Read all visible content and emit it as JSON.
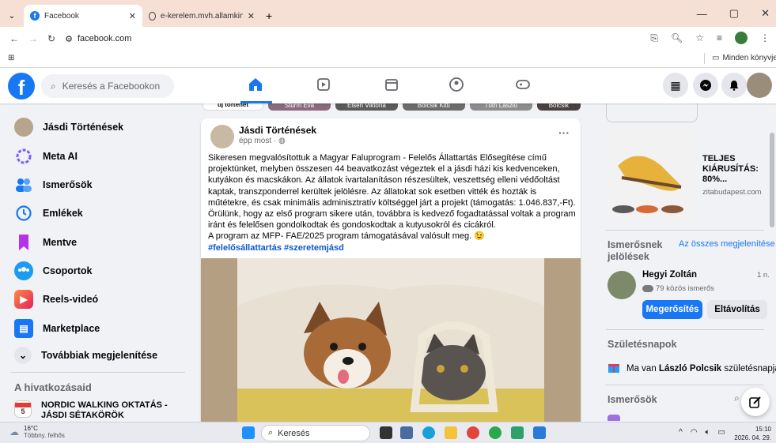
{
  "browser": {
    "tabs": [
      {
        "title": "Facebook",
        "active": true
      },
      {
        "title": "e-kerelem.mvh.allamkincstar.g",
        "active": false
      }
    ],
    "new_tab": "+",
    "url": "facebook.com",
    "bookmarks_label": "Minden könyvjelző"
  },
  "fb": {
    "search_placeholder": "Keresés a Facebookon",
    "logo": "f"
  },
  "leftnav": {
    "items": [
      {
        "label": "Jásdi Történések",
        "icon": "page-avatar"
      },
      {
        "label": "Meta AI",
        "icon": "meta-ai-icon"
      },
      {
        "label": "Ismerősök",
        "icon": "friends-icon"
      },
      {
        "label": "Emlékek",
        "icon": "memories-icon"
      },
      {
        "label": "Mentve",
        "icon": "saved-icon"
      },
      {
        "label": "Csoportok",
        "icon": "groups-icon"
      },
      {
        "label": "Reels-videó",
        "icon": "reels-icon"
      },
      {
        "label": "Marketplace",
        "icon": "marketplace-icon"
      },
      {
        "label": "Továbbiak megjelenítése",
        "icon": "chevron-down-icon"
      }
    ],
    "shortcuts_title": "A hivatkozásaid",
    "shortcut": {
      "line1": "NORDIC WALKING OKTATÁS -",
      "line2": "JÁSDI SÉTAKÖRÖK",
      "day": "5"
    }
  },
  "stories": [
    "új történet",
    "Sturm Éva",
    "Elsen Viktória",
    "Bolcsik Kitti",
    "Tóth László",
    "Bolcsik"
  ],
  "post": {
    "author": "Jásdi Történések",
    "time": "épp most ·",
    "more": "···",
    "paragraphs": [
      "Sikeresen megvalósítottuk a Magyar Faluprogram - Felelős Állattartás Elősegítése című projektünket, melyben összesen 44 beavatkozást végeztek el a jásdi házi kis kedvenceken, kutyákon és macskákon. Az állatok ivartalanításon részesültek, veszettség elleni védőoltást kaptak, transzponderrel kerültek jelölésre. Az állatokat sok esetben vitték és hozták is műtétekre, és csak minimális adminisztratív költséggel járt a projekt (támogatás: 1.046.837,-Ft).",
      "Örülünk, hogy az első program sikere után, továbbra is kedvező fogadtatással voltak a program iránt és felelősen gondolkodtak és gondoskodtak a kutyusokról és cicákról.",
      "A program az MFP- FAE/2025 program támogatásával valósult meg. 😉"
    ],
    "hashtags": "#felelősállattartás #szeretemjásd"
  },
  "right": {
    "ad": {
      "title": "TELJES KIÁRUSÍTÁS: 80%...",
      "domain": "zitabudapest.com"
    },
    "friend_requests": {
      "title": "Ismerősnek jelölések",
      "see_all": "Az összes megjelenítése",
      "name": "Hegyi Zoltán",
      "time": "1 n.",
      "mutual": "79 közös ismerős",
      "confirm": "Megerősítés",
      "remove": "Eltávolítás"
    },
    "birthdays": {
      "title": "Születésnapok",
      "text_prefix": "Ma van ",
      "name": "László Polcsik",
      "text_suffix": " születésnapja."
    },
    "contacts_title": "Ismerősök"
  },
  "taskbar": {
    "temp": "16°C",
    "weather": "Többny. felhős",
    "search": "Keresés",
    "time": "15:10",
    "date": "2026. 04. 29."
  },
  "colors": {
    "brand": "#1877f2",
    "page_bg": "#f0f2f5"
  }
}
